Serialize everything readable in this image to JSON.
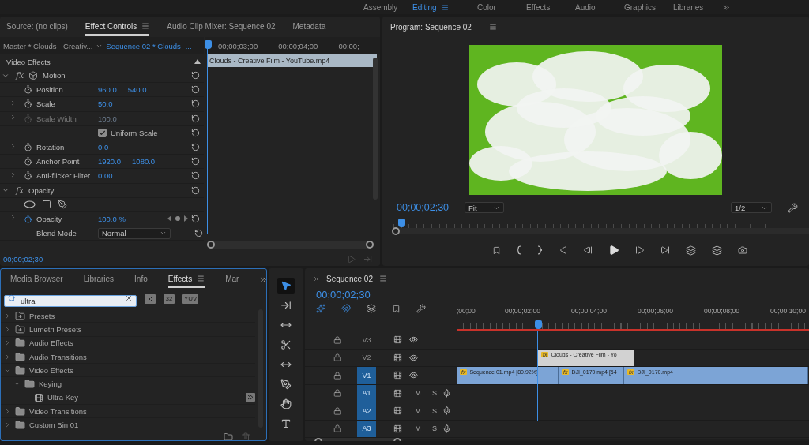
{
  "workspaces": [
    {
      "label": "Assembly",
      "selected": false
    },
    {
      "label": "Editing",
      "selected": true
    },
    {
      "label": "Color",
      "selected": false
    },
    {
      "label": "Effects",
      "selected": false
    },
    {
      "label": "Audio",
      "selected": false
    },
    {
      "label": "Graphics",
      "selected": false
    },
    {
      "label": "Libraries",
      "selected": false
    }
  ],
  "source_tabs": [
    {
      "label": "Source: (no clips)",
      "selected": false
    },
    {
      "label": "Effect Controls",
      "selected": true
    },
    {
      "label": "Audio Clip Mixer: Sequence 02",
      "selected": false
    },
    {
      "label": "Metadata",
      "selected": false
    }
  ],
  "effect_controls": {
    "master": "Master * Clouds - Creativ...",
    "sequence": "Sequence 02 * Clouds -...",
    "ruler": [
      "00;00;03;00",
      "00;00;04;00",
      "00;00;"
    ],
    "clip": "Clouds - Creative Film - YouTube.mp4",
    "section": "Video Effects",
    "timecode": "00;00;02;30",
    "rows": [
      {
        "kind": "transform_group",
        "fx": "fx",
        "name": "Motion",
        "expanded": true
      },
      {
        "kind": "param",
        "name": "Position",
        "values": [
          "960.0",
          "540.0"
        ],
        "expandable": false,
        "disabled": false,
        "animated": false,
        "keyframe_nav": false
      },
      {
        "kind": "param",
        "name": "Scale",
        "values": [
          "50.0"
        ],
        "expandable": true,
        "disabled": false,
        "animated": false,
        "keyframe_nav": false
      },
      {
        "kind": "param",
        "name": "Scale Width",
        "values": [
          "100.0"
        ],
        "expandable": true,
        "disabled": true,
        "animated": false,
        "keyframe_nav": false
      },
      {
        "kind": "checkbox",
        "label": "Uniform Scale",
        "checked": true
      },
      {
        "kind": "param",
        "name": "Rotation",
        "values": [
          "0.0"
        ],
        "expandable": true,
        "disabled": false,
        "animated": false,
        "keyframe_nav": false
      },
      {
        "kind": "param",
        "name": "Anchor Point",
        "values": [
          "1920.0",
          "1080.0"
        ],
        "expandable": false,
        "disabled": false,
        "animated": false,
        "keyframe_nav": false
      },
      {
        "kind": "param",
        "name": "Anti-flicker Filter",
        "values": [
          "0.00"
        ],
        "expandable": true,
        "disabled": false,
        "animated": false,
        "keyframe_nav": false
      },
      {
        "kind": "group",
        "fx": "fx",
        "name": "Opacity",
        "expanded": true
      },
      {
        "kind": "mask_tools"
      },
      {
        "kind": "param",
        "name": "Opacity",
        "values": [
          "100.0 %"
        ],
        "expandable": true,
        "disabled": false,
        "animated": true,
        "keyframe_nav": true
      },
      {
        "kind": "dropdown",
        "name": "Blend Mode",
        "value": "Normal"
      }
    ]
  },
  "program": {
    "title": "Program: Sequence 02",
    "timecode": "00;00;02;30",
    "zoom": "Fit",
    "resolution": "1/2"
  },
  "effects_tabs": [
    {
      "label": "Media Browser",
      "selected": false
    },
    {
      "label": "Libraries",
      "selected": false
    },
    {
      "label": "Info",
      "selected": false
    },
    {
      "label": "Effects",
      "selected": true
    },
    {
      "label": "Mar",
      "selected": false
    }
  ],
  "effects_search": {
    "value": "ultra"
  },
  "filter_buttons": [
    {
      "kind": "accelerated"
    },
    {
      "kind": "text",
      "label": "32"
    },
    {
      "kind": "text",
      "label": "YUV"
    }
  ],
  "effects_tree": [
    {
      "name": "Presets",
      "kind": "preset_bin",
      "expanded": false
    },
    {
      "name": "Lumetri Presets",
      "kind": "preset_bin",
      "expanded": false
    },
    {
      "name": "Audio Effects",
      "kind": "folder",
      "expanded": false
    },
    {
      "name": "Audio Transitions",
      "kind": "folder",
      "expanded": false
    },
    {
      "name": "Video Effects",
      "kind": "folder",
      "expanded": true,
      "children": [
        {
          "name": "Keying",
          "kind": "folder",
          "expanded": true,
          "children": [
            {
              "name": "Ultra Key",
              "kind": "effect",
              "accelerated": true
            }
          ]
        }
      ]
    },
    {
      "name": "Video Transitions",
      "kind": "folder",
      "expanded": false
    },
    {
      "name": "Custom Bin 01",
      "kind": "folder",
      "expanded": false
    }
  ],
  "tools": [
    {
      "kind": "select",
      "selected": true
    },
    {
      "kind": "track_select",
      "selected": false
    },
    {
      "kind": "ripple",
      "selected": false
    },
    {
      "kind": "razor",
      "selected": false
    },
    {
      "kind": "slip",
      "selected": false
    },
    {
      "kind": "pen",
      "selected": false
    },
    {
      "kind": "hand",
      "selected": false
    },
    {
      "kind": "type",
      "selected": false
    }
  ],
  "timeline": {
    "title": "Sequence 02",
    "timecode": "00;00;02;30",
    "ruler": [
      ";00;00",
      "00;00;02;00",
      "00;00;04;00",
      "00;00;06;00",
      "00;00;08;00",
      "00;00;10;00"
    ],
    "tracks": [
      {
        "name": "V3",
        "kind": "video",
        "targeted": false
      },
      {
        "name": "V2",
        "kind": "video",
        "targeted": false,
        "clips": [
          {
            "badge": "fx",
            "name": "Clouds - Creative Film - Yo",
            "selected": true
          }
        ]
      },
      {
        "name": "V1",
        "kind": "video",
        "targeted": true,
        "clips": [
          {
            "badge": "fx",
            "name": "Sequence 01.mp4 [80.92%]",
            "selected": false
          },
          {
            "badge": "fx",
            "name": "DJI_0170.mp4 [54",
            "selected": false
          },
          {
            "badge": "fx",
            "name": "DJI_0170.mp4",
            "selected": false
          }
        ]
      },
      {
        "name": "A1",
        "kind": "audio",
        "targeted": true,
        "mute": "M",
        "solo": "S"
      },
      {
        "name": "A2",
        "kind": "audio",
        "targeted": true,
        "mute": "M",
        "solo": "S"
      },
      {
        "name": "A3",
        "kind": "audio",
        "targeted": true,
        "mute": "M",
        "solo": "S"
      }
    ]
  }
}
